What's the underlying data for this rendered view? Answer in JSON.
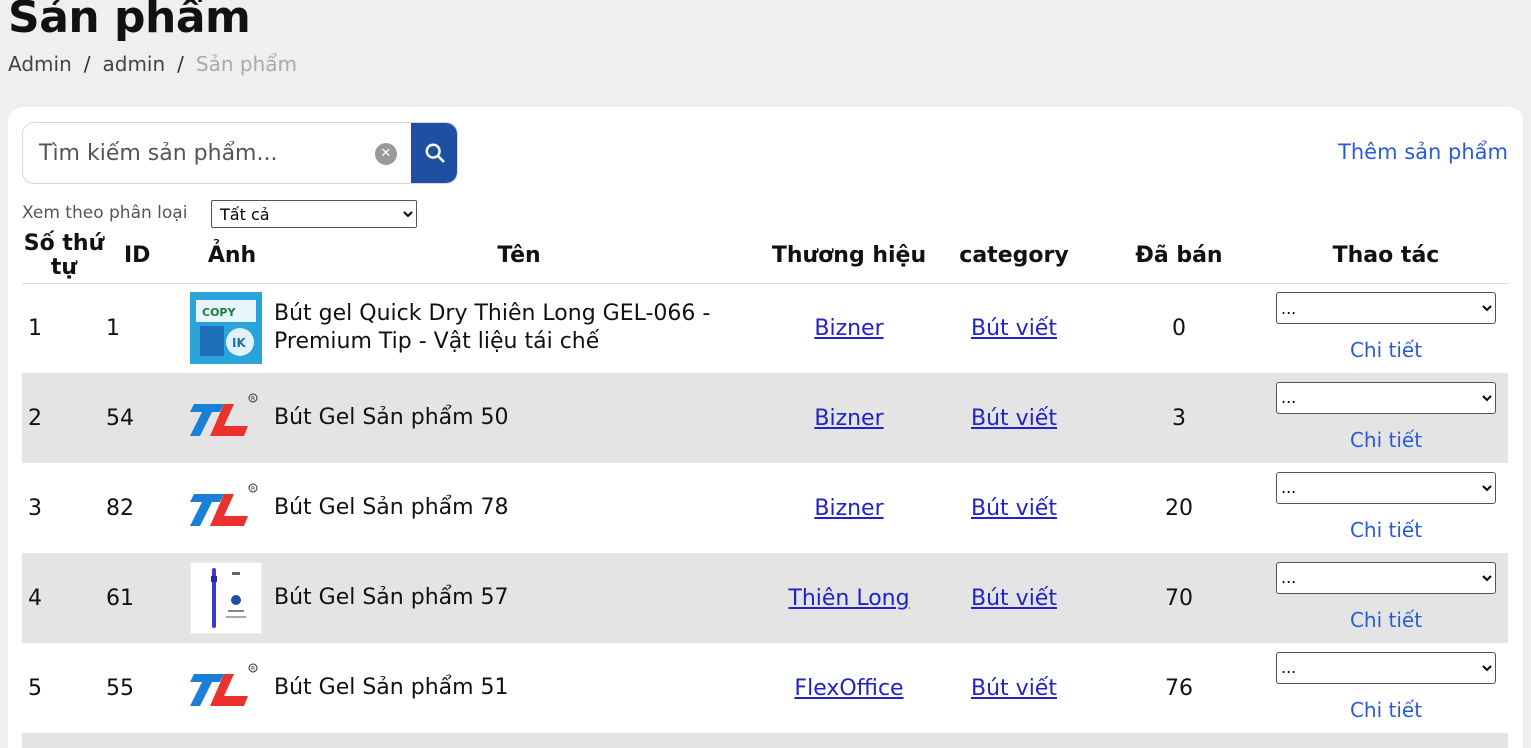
{
  "page": {
    "title": "Sản phẩm",
    "breadcrumb": [
      "Admin",
      "admin",
      "Sản phẩm"
    ]
  },
  "search": {
    "placeholder": "Tìm kiếm sản phẩm...",
    "value": ""
  },
  "add_product_label": "Thêm sản phẩm",
  "filter": {
    "label": "Xem theo phân loại",
    "selected": "Tất cả"
  },
  "table": {
    "headers": {
      "stt": "Số thứ tự",
      "id": "ID",
      "image": "Ảnh",
      "name": "Tên",
      "brand": "Thương hiệu",
      "category": "category",
      "sold": "Đã bán",
      "actions": "Thao tác"
    },
    "action_select": "...",
    "detail_label": "Chi tiết",
    "rows": [
      {
        "stt": "1",
        "id": "1",
        "image": "copy-paper-product-image",
        "name": "Bút gel Quick Dry Thiên Long GEL-066 - Premium Tip - Vật liệu tái chế",
        "brand": "Bizner",
        "category": "Bút viết",
        "sold": "0"
      },
      {
        "stt": "2",
        "id": "54",
        "image": "thien-long-logo",
        "name": "Bút Gel Sản phẩm 50",
        "brand": "Bizner",
        "category": "Bút viết",
        "sold": "3"
      },
      {
        "stt": "3",
        "id": "82",
        "image": "thien-long-logo",
        "name": "Bút Gel Sản phẩm 78",
        "brand": "Bizner",
        "category": "Bút viết",
        "sold": "20"
      },
      {
        "stt": "4",
        "id": "61",
        "image": "gel-pen-product-image",
        "name": "Bút Gel Sản phẩm 57",
        "brand": "Thiên Long",
        "category": "Bút viết",
        "sold": "70"
      },
      {
        "stt": "5",
        "id": "55",
        "image": "thien-long-logo",
        "name": "Bút Gel Sản phẩm 51",
        "brand": "FlexOffice",
        "category": "Bút viết",
        "sold": "76"
      }
    ]
  },
  "colors": {
    "accent": "#2a5bd7",
    "search_button": "#1f4fa0",
    "row_shade": "#e4e4e4",
    "logo_blue": "#1a7fd6",
    "logo_red": "#e8322b"
  }
}
